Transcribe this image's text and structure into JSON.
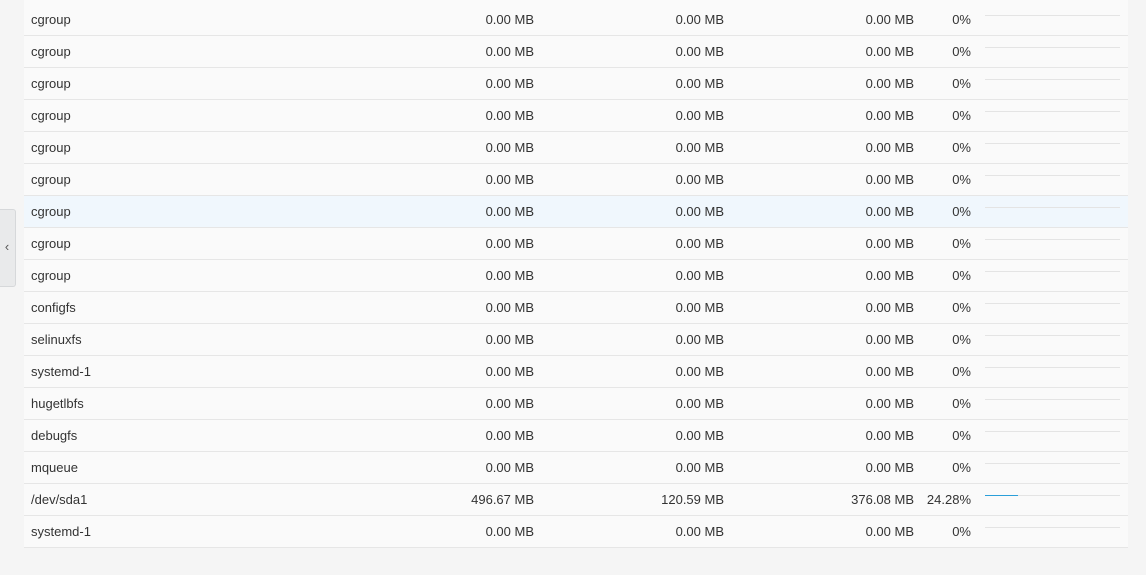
{
  "sidebar_toggle": {
    "icon": "chevron-left-icon",
    "glyph": "‹"
  },
  "colors": {
    "usage_bar": "#2b9fd9",
    "row_hover": "#f0f7fd"
  },
  "filesystems": {
    "rows": [
      {
        "name": "cgroup",
        "size": "0.00 MB",
        "used": "0.00 MB",
        "available": "0.00 MB",
        "percent": "0%",
        "usage": 0
      },
      {
        "name": "cgroup",
        "size": "0.00 MB",
        "used": "0.00 MB",
        "available": "0.00 MB",
        "percent": "0%",
        "usage": 0
      },
      {
        "name": "cgroup",
        "size": "0.00 MB",
        "used": "0.00 MB",
        "available": "0.00 MB",
        "percent": "0%",
        "usage": 0
      },
      {
        "name": "cgroup",
        "size": "0.00 MB",
        "used": "0.00 MB",
        "available": "0.00 MB",
        "percent": "0%",
        "usage": 0
      },
      {
        "name": "cgroup",
        "size": "0.00 MB",
        "used": "0.00 MB",
        "available": "0.00 MB",
        "percent": "0%",
        "usage": 0
      },
      {
        "name": "cgroup",
        "size": "0.00 MB",
        "used": "0.00 MB",
        "available": "0.00 MB",
        "percent": "0%",
        "usage": 0
      },
      {
        "name": "cgroup",
        "size": "0.00 MB",
        "used": "0.00 MB",
        "available": "0.00 MB",
        "percent": "0%",
        "usage": 0,
        "hover": true
      },
      {
        "name": "cgroup",
        "size": "0.00 MB",
        "used": "0.00 MB",
        "available": "0.00 MB",
        "percent": "0%",
        "usage": 0
      },
      {
        "name": "cgroup",
        "size": "0.00 MB",
        "used": "0.00 MB",
        "available": "0.00 MB",
        "percent": "0%",
        "usage": 0
      },
      {
        "name": "configfs",
        "size": "0.00 MB",
        "used": "0.00 MB",
        "available": "0.00 MB",
        "percent": "0%",
        "usage": 0
      },
      {
        "name": "selinuxfs",
        "size": "0.00 MB",
        "used": "0.00 MB",
        "available": "0.00 MB",
        "percent": "0%",
        "usage": 0
      },
      {
        "name": "systemd-1",
        "size": "0.00 MB",
        "used": "0.00 MB",
        "available": "0.00 MB",
        "percent": "0%",
        "usage": 0
      },
      {
        "name": "hugetlbfs",
        "size": "0.00 MB",
        "used": "0.00 MB",
        "available": "0.00 MB",
        "percent": "0%",
        "usage": 0
      },
      {
        "name": "debugfs",
        "size": "0.00 MB",
        "used": "0.00 MB",
        "available": "0.00 MB",
        "percent": "0%",
        "usage": 0
      },
      {
        "name": "mqueue",
        "size": "0.00 MB",
        "used": "0.00 MB",
        "available": "0.00 MB",
        "percent": "0%",
        "usage": 0
      },
      {
        "name": "/dev/sda1",
        "size": "496.67 MB",
        "used": "120.59 MB",
        "available": "376.08 MB",
        "percent": "24.28%",
        "usage": 0.2428
      },
      {
        "name": "systemd-1",
        "size": "0.00 MB",
        "used": "0.00 MB",
        "available": "0.00 MB",
        "percent": "0%",
        "usage": 0
      }
    ]
  }
}
